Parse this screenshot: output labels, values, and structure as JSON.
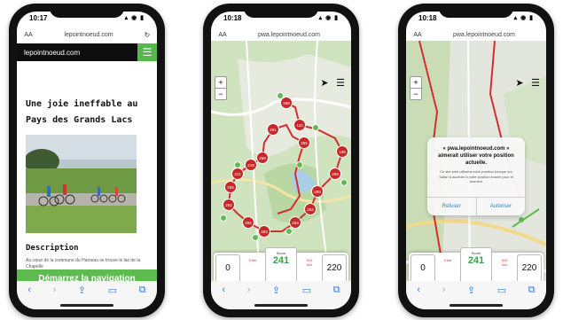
{
  "phone1": {
    "status": {
      "time": "10:17"
    },
    "url": "lepointnoeud.com",
    "aa": "AA",
    "logo": "lepointnoeud.com",
    "title": "Une joie ineffable au Pays des Grands Lacs",
    "section": "Description",
    "snippet": "Au cœur de la commune du Hameau se trouve le lac de la Chapelle",
    "cta": "Démarrez la navigation"
  },
  "phone2": {
    "status": {
      "time": "10:18"
    },
    "url": "pwa.lepointnoeud.com",
    "aa": "AA",
    "zoom_in": "+",
    "zoom_out": "−",
    "counter": {
      "left": "0",
      "label": "Score",
      "value": "241",
      "right": "220",
      "sub1": "0 km",
      "sub2": "510 km"
    },
    "nodes": [
      "298",
      "110",
      "291",
      "269",
      "198",
      "289",
      "218",
      "211",
      "205",
      "292",
      "255",
      "283",
      "253",
      "262",
      "289",
      "285"
    ]
  },
  "phone3": {
    "status": {
      "time": "10:18"
    },
    "url": "pwa.lepointnoeud.com",
    "aa": "AA",
    "zoom_in": "+",
    "zoom_out": "−",
    "dialog": {
      "title": "« pwa.lepointnoeud.com » aimerait utiliser votre position actuelle.",
      "body": "Ce site web utilisera votre position lorsque sur Safari à accéder à votre position exacte pour le moment",
      "deny": "Refuser",
      "allow": "Autoriser"
    },
    "counter": {
      "left": "0",
      "label": "Score",
      "value": "241",
      "right": "220",
      "sub1": "0 km",
      "sub2": "510 km"
    }
  },
  "colors": {
    "green": "#5dbb50",
    "red": "#c62828",
    "ios_blue": "#2d7be0"
  }
}
